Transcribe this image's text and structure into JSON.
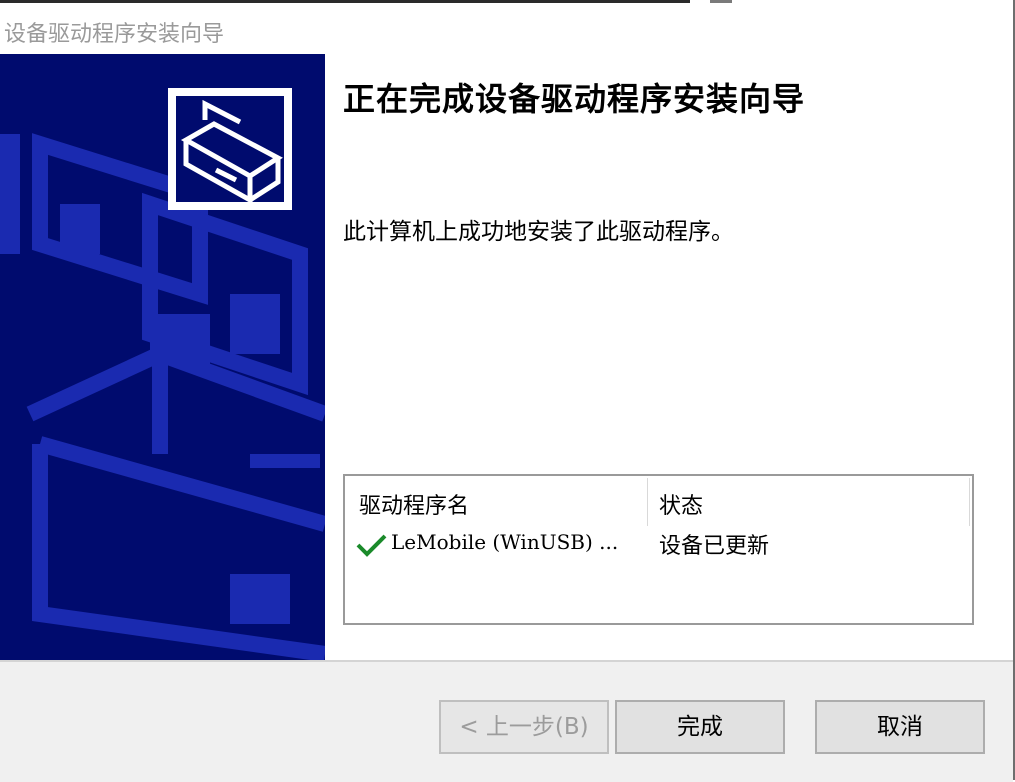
{
  "window": {
    "title": "设备驱动程序安装向导"
  },
  "main": {
    "heading": "正在完成设备驱动程序安装向导",
    "message": "此计算机上成功地安装了此驱动程序。"
  },
  "driver_table": {
    "columns": [
      "驱动程序名",
      "状态"
    ],
    "rows": [
      {
        "name": "LeMobile (WinUSB) ...",
        "status": "设备已更新",
        "icon": "checkmark-icon"
      }
    ]
  },
  "buttons": {
    "back": "< 上一步(B)",
    "finish": "完成",
    "cancel": "取消"
  },
  "colors": {
    "sidebar": "#000b6e",
    "sidebar_art": "#1a2ab0",
    "check": "#1a8a2a"
  }
}
